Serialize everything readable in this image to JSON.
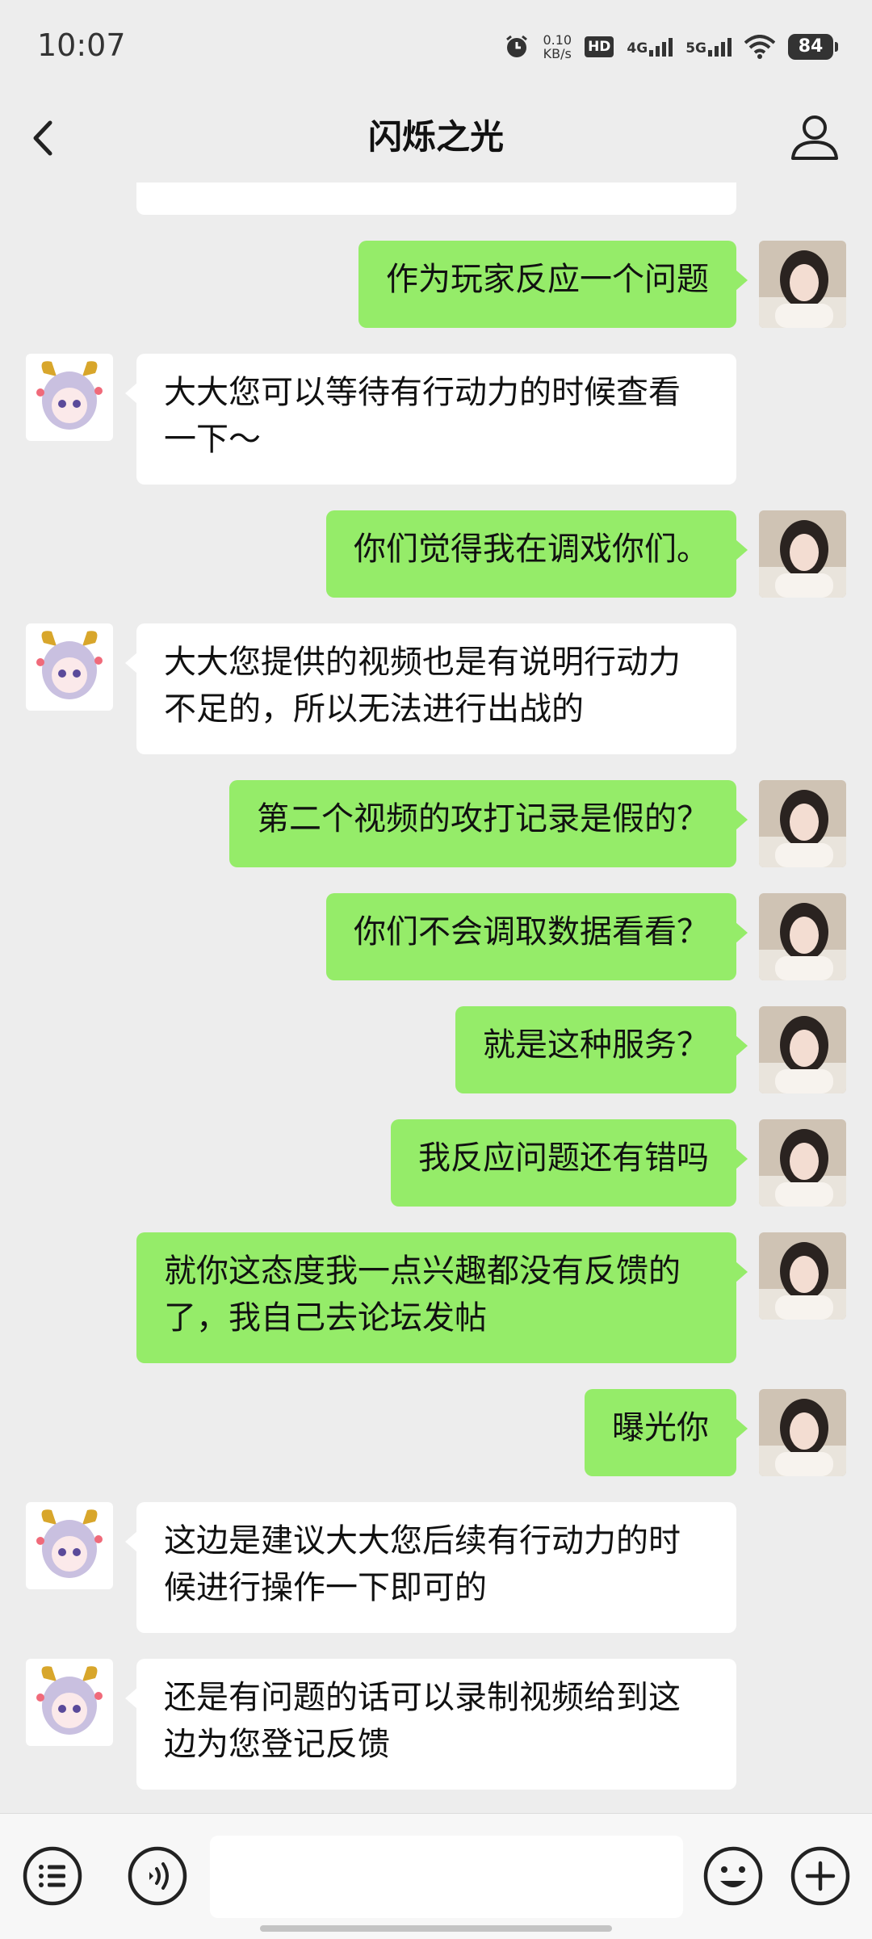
{
  "status_bar": {
    "time": "10:07",
    "net_speed_value": "0.10",
    "net_speed_unit": "KB/s",
    "hd_label": "HD",
    "signal_1": "4G",
    "signal_2": "5G",
    "battery": "84",
    "icons": [
      "alarm-icon",
      "hd-icon",
      "signal-4g-icon",
      "signal-5g-icon",
      "wifi-icon",
      "battery-icon"
    ]
  },
  "header": {
    "title": "闪烁之光",
    "back_icon": "chevron-left-icon",
    "profile_icon": "person-icon"
  },
  "messages": [
    {
      "side": "in",
      "text": ""
    },
    {
      "side": "out",
      "text": "作为玩家反应一个问题"
    },
    {
      "side": "in",
      "text": "大大您可以等待有行动力的时候查看一下～"
    },
    {
      "side": "out",
      "text": "你们觉得我在调戏你们。"
    },
    {
      "side": "in",
      "text": "大大您提供的视频也是有说明行动力不足的，所以无法进行出战的"
    },
    {
      "side": "out",
      "text": "第二个视频的攻打记录是假的？"
    },
    {
      "side": "out",
      "text": "你们不会调取数据看看？"
    },
    {
      "side": "out",
      "text": "就是这种服务？"
    },
    {
      "side": "out",
      "text": "我反应问题还有错吗"
    },
    {
      "side": "out",
      "text": "就你这态度我一点兴趣都没有反馈的了，我自己去论坛发帖"
    },
    {
      "side": "out",
      "text": "曝光你"
    },
    {
      "side": "in",
      "text": "这边是建议大大您后续有行动力的时候进行操作一下即可的"
    },
    {
      "side": "in",
      "text": "还是有问题的话可以录制视频给到这边为您登记反馈"
    }
  ],
  "input_bar": {
    "message_value": "",
    "left_icons": [
      "menu-list-icon",
      "voice-icon"
    ],
    "right_icons": [
      "emoji-icon",
      "plus-icon"
    ]
  },
  "colors": {
    "background": "#ededed",
    "outgoing_bubble": "#95ec69",
    "incoming_bubble": "#ffffff",
    "input_bar": "#f7f7f7"
  }
}
